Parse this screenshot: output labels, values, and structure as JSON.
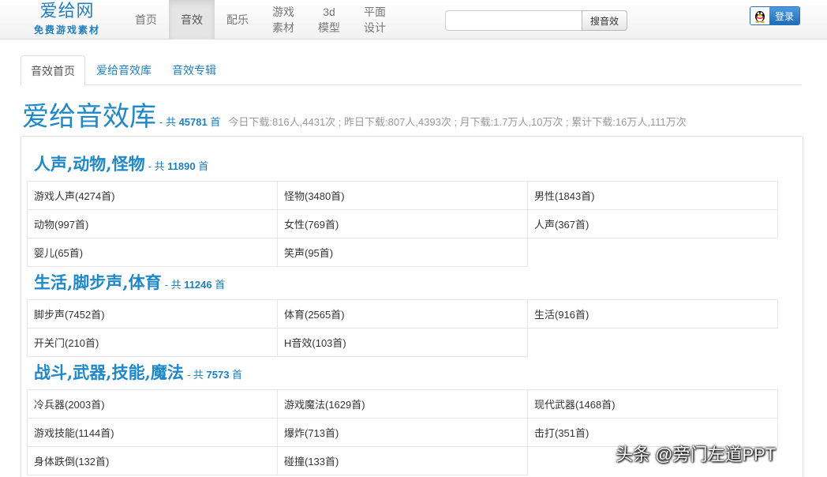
{
  "logo": {
    "title": "爱给网",
    "subtitle": "免费游戏素材"
  },
  "nav": [
    {
      "lines": [
        "首页"
      ]
    },
    {
      "lines": [
        "音效"
      ],
      "active": true
    },
    {
      "lines": [
        "配乐"
      ]
    },
    {
      "lines": [
        "游戏",
        "素材"
      ]
    },
    {
      "lines": [
        "3d",
        "模型"
      ]
    },
    {
      "lines": [
        "平面",
        "设计"
      ]
    }
  ],
  "search": {
    "value": "",
    "placeholder": "",
    "button": "搜音效"
  },
  "login": {
    "label": "登录",
    "icon": "qq-penguin-icon"
  },
  "subtabs": [
    {
      "label": "音效首页",
      "active": true
    },
    {
      "label": "爱给音效库"
    },
    {
      "label": "音效专辑"
    }
  ],
  "heading": {
    "title": "爱给音效库",
    "count_prefix": "- 共 ",
    "count": "45781",
    "count_suffix": " 首",
    "stats": "今日下载:816人,4431次 ; 昨日下载:807人,4393次 ; 月下载:1.7万人,10万次 ; 累计下载:16万人,111万次"
  },
  "categories": [
    {
      "title": "人声,动物,怪物",
      "count_prefix": "- 共 ",
      "count": "11890",
      "count_suffix": " 首",
      "items": [
        "游戏人声(4274首)",
        "怪物(3480首)",
        "男性(1843首)",
        "动物(997首)",
        "女性(769首)",
        "人声(367首)",
        "婴儿(65首)",
        "笑声(95首)"
      ]
    },
    {
      "title": "生活,脚步声,体育",
      "count_prefix": "- 共 ",
      "count": "11246",
      "count_suffix": " 首",
      "items": [
        "脚步声(7452首)",
        "体育(2565首)",
        "生活(916首)",
        "开关门(210首)",
        "H音效(103首)"
      ]
    },
    {
      "title": "战斗,武器,技能,魔法",
      "count_prefix": "- 共 ",
      "count": "7573",
      "count_suffix": " 首",
      "items": [
        "冷兵器(2003首)",
        "游戏魔法(1629首)",
        "现代武器(1468首)",
        "游戏技能(1144首)",
        "爆炸(713首)",
        "击打(351首)",
        "身体跌倒(132首)",
        "碰撞(133首)"
      ]
    }
  ],
  "watermark": "头条 @旁门左道PPT"
}
